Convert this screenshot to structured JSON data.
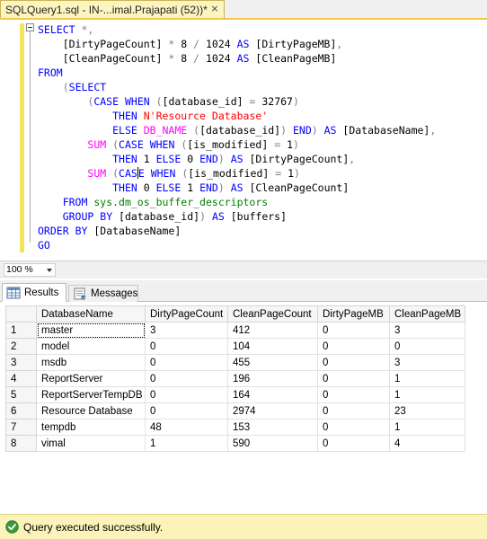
{
  "window": {
    "tab_title": "SQLQuery1.sql - IN-...imal.Prajapati (52))*",
    "close_glyph": "×"
  },
  "editor": {
    "lines": [
      [
        {
          "t": "SELECT",
          "c": "kw"
        },
        {
          "t": " ",
          "c": ""
        },
        {
          "t": "*,",
          "c": "gr"
        }
      ],
      [
        {
          "t": "    [DirtyPageCount] ",
          "c": ""
        },
        {
          "t": "*",
          "c": "gr"
        },
        {
          "t": " 8 ",
          "c": ""
        },
        {
          "t": "/",
          "c": "gr"
        },
        {
          "t": " 1024 ",
          "c": ""
        },
        {
          "t": "AS",
          "c": "kw"
        },
        {
          "t": " [DirtyPageMB]",
          "c": ""
        },
        {
          "t": ",",
          "c": "gr"
        }
      ],
      [
        {
          "t": "    [CleanPageCount] ",
          "c": ""
        },
        {
          "t": "*",
          "c": "gr"
        },
        {
          "t": " 8 ",
          "c": ""
        },
        {
          "t": "/",
          "c": "gr"
        },
        {
          "t": " 1024 ",
          "c": ""
        },
        {
          "t": "AS",
          "c": "kw"
        },
        {
          "t": " [CleanPageMB]",
          "c": ""
        }
      ],
      [
        {
          "t": "FROM",
          "c": "kw"
        }
      ],
      [
        {
          "t": "    ",
          "c": ""
        },
        {
          "t": "(",
          "c": "gr"
        },
        {
          "t": "SELECT",
          "c": "kw"
        }
      ],
      [
        {
          "t": "        ",
          "c": ""
        },
        {
          "t": "(",
          "c": "gr"
        },
        {
          "t": "CASE",
          "c": "kw"
        },
        {
          "t": " ",
          "c": ""
        },
        {
          "t": "WHEN",
          "c": "kw"
        },
        {
          "t": " ",
          "c": ""
        },
        {
          "t": "(",
          "c": "gr"
        },
        {
          "t": "[database_id] ",
          "c": ""
        },
        {
          "t": "=",
          "c": "gr"
        },
        {
          "t": " 32767",
          "c": ""
        },
        {
          "t": ")",
          "c": "gr"
        }
      ],
      [
        {
          "t": "            ",
          "c": ""
        },
        {
          "t": "THEN",
          "c": "kw"
        },
        {
          "t": " ",
          "c": ""
        },
        {
          "t": "N'Resource Database'",
          "c": "str"
        }
      ],
      [
        {
          "t": "            ",
          "c": ""
        },
        {
          "t": "ELSE",
          "c": "kw"
        },
        {
          "t": " ",
          "c": ""
        },
        {
          "t": "DB_NAME",
          "c": "fn"
        },
        {
          "t": " ",
          "c": ""
        },
        {
          "t": "(",
          "c": "gr"
        },
        {
          "t": "[database_id]",
          "c": ""
        },
        {
          "t": ")",
          "c": "gr"
        },
        {
          "t": " ",
          "c": ""
        },
        {
          "t": "END",
          "c": "kw"
        },
        {
          "t": ")",
          "c": "gr"
        },
        {
          "t": " ",
          "c": ""
        },
        {
          "t": "AS",
          "c": "kw"
        },
        {
          "t": " [DatabaseName]",
          "c": ""
        },
        {
          "t": ",",
          "c": "gr"
        }
      ],
      [
        {
          "t": "        ",
          "c": ""
        },
        {
          "t": "SUM",
          "c": "fn"
        },
        {
          "t": " ",
          "c": ""
        },
        {
          "t": "(",
          "c": "gr"
        },
        {
          "t": "CASE",
          "c": "kw"
        },
        {
          "t": " ",
          "c": ""
        },
        {
          "t": "WHEN",
          "c": "kw"
        },
        {
          "t": " ",
          "c": ""
        },
        {
          "t": "(",
          "c": "gr"
        },
        {
          "t": "[is_modified] ",
          "c": ""
        },
        {
          "t": "=",
          "c": "gr"
        },
        {
          "t": " 1",
          "c": ""
        },
        {
          "t": ")",
          "c": "gr"
        }
      ],
      [
        {
          "t": "            ",
          "c": ""
        },
        {
          "t": "THEN",
          "c": "kw"
        },
        {
          "t": " 1 ",
          "c": ""
        },
        {
          "t": "ELSE",
          "c": "kw"
        },
        {
          "t": " 0 ",
          "c": ""
        },
        {
          "t": "END",
          "c": "kw"
        },
        {
          "t": ")",
          "c": "gr"
        },
        {
          "t": " ",
          "c": ""
        },
        {
          "t": "AS",
          "c": "kw"
        },
        {
          "t": " [DirtyPageCount]",
          "c": ""
        },
        {
          "t": ",",
          "c": "gr"
        }
      ],
      [
        {
          "t": "        ",
          "c": ""
        },
        {
          "t": "SUM",
          "c": "fn"
        },
        {
          "t": " ",
          "c": ""
        },
        {
          "t": "(",
          "c": "gr"
        },
        {
          "t": "CAS",
          "c": "kw"
        },
        {
          "t": "|",
          "c": "cursor"
        },
        {
          "t": "E",
          "c": "kw"
        },
        {
          "t": " ",
          "c": ""
        },
        {
          "t": "WHEN",
          "c": "kw"
        },
        {
          "t": " ",
          "c": ""
        },
        {
          "t": "(",
          "c": "gr"
        },
        {
          "t": "[is_modified] ",
          "c": ""
        },
        {
          "t": "=",
          "c": "gr"
        },
        {
          "t": " 1",
          "c": ""
        },
        {
          "t": ")",
          "c": "gr"
        }
      ],
      [
        {
          "t": "            ",
          "c": ""
        },
        {
          "t": "THEN",
          "c": "kw"
        },
        {
          "t": " 0 ",
          "c": ""
        },
        {
          "t": "ELSE",
          "c": "kw"
        },
        {
          "t": " 1 ",
          "c": ""
        },
        {
          "t": "END",
          "c": "kw"
        },
        {
          "t": ")",
          "c": "gr"
        },
        {
          "t": " ",
          "c": ""
        },
        {
          "t": "AS",
          "c": "kw"
        },
        {
          "t": " [CleanPageCount]",
          "c": ""
        }
      ],
      [
        {
          "t": "    ",
          "c": ""
        },
        {
          "t": "FROM",
          "c": "kw"
        },
        {
          "t": " ",
          "c": ""
        },
        {
          "t": "sys.dm_os_buffer_descriptors",
          "c": "sys"
        }
      ],
      [
        {
          "t": "    ",
          "c": ""
        },
        {
          "t": "GROUP",
          "c": "kw"
        },
        {
          "t": " ",
          "c": ""
        },
        {
          "t": "BY",
          "c": "kw"
        },
        {
          "t": " [database_id]",
          "c": ""
        },
        {
          "t": ")",
          "c": "gr"
        },
        {
          "t": " ",
          "c": ""
        },
        {
          "t": "AS",
          "c": "kw"
        },
        {
          "t": " [buffers]",
          "c": ""
        }
      ],
      [
        {
          "t": "ORDER",
          "c": "kw"
        },
        {
          "t": " ",
          "c": ""
        },
        {
          "t": "BY",
          "c": "kw"
        },
        {
          "t": " [DatabaseName]",
          "c": ""
        }
      ],
      [
        {
          "t": "GO",
          "c": "kw"
        }
      ]
    ]
  },
  "zoom": {
    "value": "100 %"
  },
  "result_tabs": {
    "results": "Results",
    "messages": "Messages"
  },
  "grid": {
    "columns": [
      "DatabaseName",
      "DirtyPageCount",
      "CleanPageCount",
      "DirtyPageMB",
      "CleanPageMB"
    ],
    "rows": [
      {
        "n": "1",
        "cells": [
          "master",
          "3",
          "412",
          "0",
          "3"
        ]
      },
      {
        "n": "2",
        "cells": [
          "model",
          "0",
          "104",
          "0",
          "0"
        ]
      },
      {
        "n": "3",
        "cells": [
          "msdb",
          "0",
          "455",
          "0",
          "3"
        ]
      },
      {
        "n": "4",
        "cells": [
          "ReportServer",
          "0",
          "196",
          "0",
          "1"
        ]
      },
      {
        "n": "5",
        "cells": [
          "ReportServerTempDB",
          "0",
          "164",
          "0",
          "1"
        ]
      },
      {
        "n": "6",
        "cells": [
          "Resource Database",
          "0",
          "2974",
          "0",
          "23"
        ]
      },
      {
        "n": "7",
        "cells": [
          "tempdb",
          "48",
          "153",
          "0",
          "1"
        ]
      },
      {
        "n": "8",
        "cells": [
          "vimal",
          "1",
          "590",
          "0",
          "4"
        ]
      }
    ]
  },
  "status": {
    "text": "Query executed successfully.",
    "icon": "check-circle-icon",
    "color": "#fbf3ba"
  }
}
